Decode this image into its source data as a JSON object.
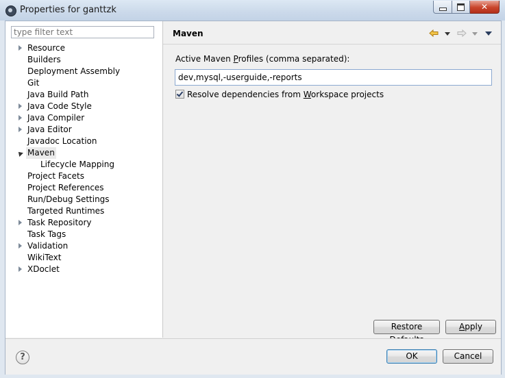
{
  "window": {
    "title": "Properties for ganttzk",
    "icon": "settings-gear-icon"
  },
  "filter": {
    "placeholder": "type filter text"
  },
  "tree": {
    "items": [
      {
        "label": "Resource",
        "expandable": true
      },
      {
        "label": "Builders",
        "expandable": false
      },
      {
        "label": "Deployment Assembly",
        "expandable": false
      },
      {
        "label": "Git",
        "expandable": false
      },
      {
        "label": "Java Build Path",
        "expandable": false
      },
      {
        "label": "Java Code Style",
        "expandable": true
      },
      {
        "label": "Java Compiler",
        "expandable": true
      },
      {
        "label": "Java Editor",
        "expandable": true
      },
      {
        "label": "Javadoc Location",
        "expandable": false
      },
      {
        "label": "Maven",
        "expandable": true,
        "expanded": true,
        "selected": true
      },
      {
        "label": "Lifecycle Mapping",
        "child": true
      },
      {
        "label": "Project Facets",
        "expandable": false
      },
      {
        "label": "Project References",
        "expandable": false
      },
      {
        "label": "Run/Debug Settings",
        "expandable": false
      },
      {
        "label": "Targeted Runtimes",
        "expandable": false
      },
      {
        "label": "Task Repository",
        "expandable": true
      },
      {
        "label": "Task Tags",
        "expandable": false
      },
      {
        "label": "Validation",
        "expandable": true
      },
      {
        "label": "WikiText",
        "expandable": false
      },
      {
        "label": "XDoclet",
        "expandable": true
      }
    ]
  },
  "page": {
    "title": "Maven",
    "profiles_label_pre": "Active Maven ",
    "profiles_label_mnemonic": "P",
    "profiles_label_post": "rofiles (comma separated):",
    "profiles_value": "dev,mysql,-userguide,-reports",
    "resolve_label_pre": "Resolve dependencies from ",
    "resolve_label_mnemonic": "W",
    "resolve_label_post": "orkspace projects",
    "resolve_checked": true
  },
  "buttons": {
    "restore_pre": "Restore ",
    "restore_mnemonic": "D",
    "restore_post": "efaults",
    "apply_mnemonic": "A",
    "apply_post": "pply",
    "ok": "OK",
    "cancel": "Cancel"
  },
  "colors": {
    "back_arrow": "#e2a42a",
    "forward_arrow": "#c8c8c8"
  }
}
